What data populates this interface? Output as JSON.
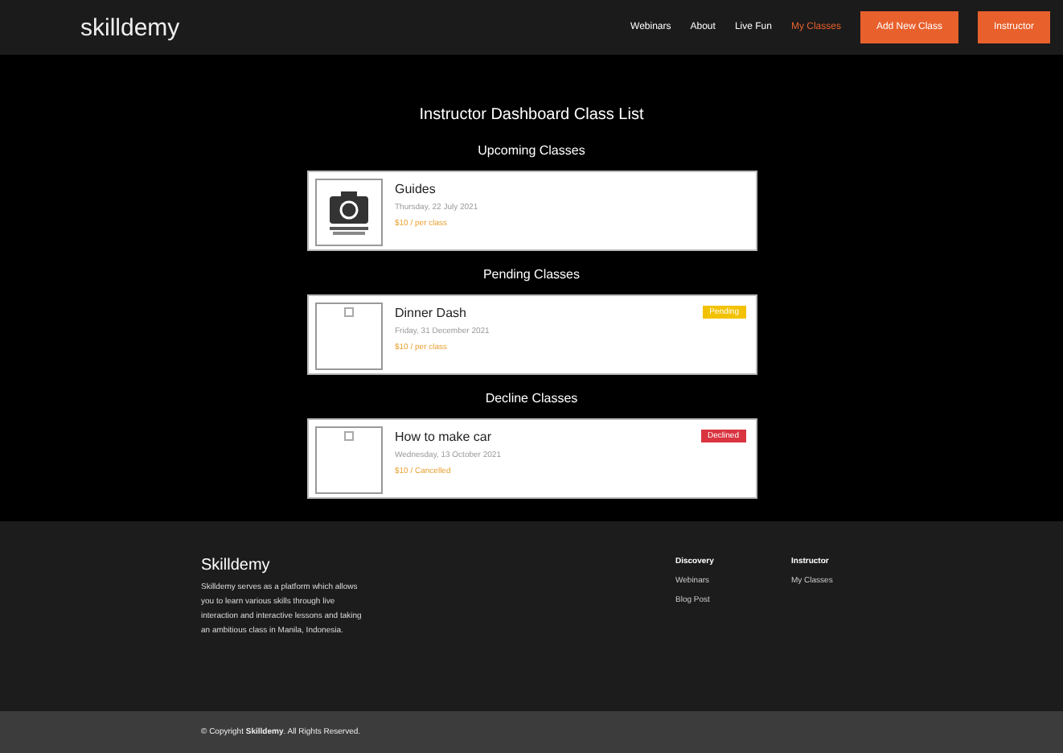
{
  "navbar": {
    "logo": "skilldemy",
    "links": [
      {
        "label": "Webinars",
        "selected": false
      },
      {
        "label": "About",
        "selected": false
      },
      {
        "label": "Live Fun",
        "selected": false
      },
      {
        "label": "My Classes",
        "selected": true
      }
    ],
    "buttons": [
      "Add New Class",
      "Instructor"
    ]
  },
  "page_title": "Instructor Dashboard Class List",
  "sections": [
    {
      "heading": "Upcoming Classes",
      "classes": [
        {
          "title": "Guides",
          "kind": "camera",
          "date": "Thursday, 22 July 2021",
          "note": "$10 / per class"
        }
      ]
    },
    {
      "heading": "Pending Classes",
      "classes": [
        {
          "title": "Dinner Dash",
          "kind": "broken",
          "date": "Friday, 31 December 2021",
          "note": "$10 / per class",
          "badge": {
            "label": "Pending",
            "color": "#f2c200"
          }
        }
      ]
    },
    {
      "heading": "Decline Classes",
      "classes": [
        {
          "title": "How to make car",
          "kind": "broken",
          "date": "Wednesday, 13 October 2021",
          "note": "$10 / Cancelled",
          "badge": {
            "label": "Declined",
            "color": "#d9343f"
          }
        }
      ]
    }
  ],
  "footer": {
    "brand": "Skilldemy",
    "description": "Skilldemy serves as a platform which allows you to learn various skills through live interaction and interactive lessons and taking an ambitious class in Manila, Indonesia.",
    "columns": [
      {
        "heading": "Discovery",
        "links": [
          "Webinars",
          "Blog Post"
        ]
      },
      {
        "heading": "Instructor",
        "links": [
          "My Classes"
        ]
      }
    ]
  },
  "copyright": {
    "prefix": "© Copyright ",
    "brand": "Skilldemy",
    "suffix": ". All Rights Reserved."
  }
}
